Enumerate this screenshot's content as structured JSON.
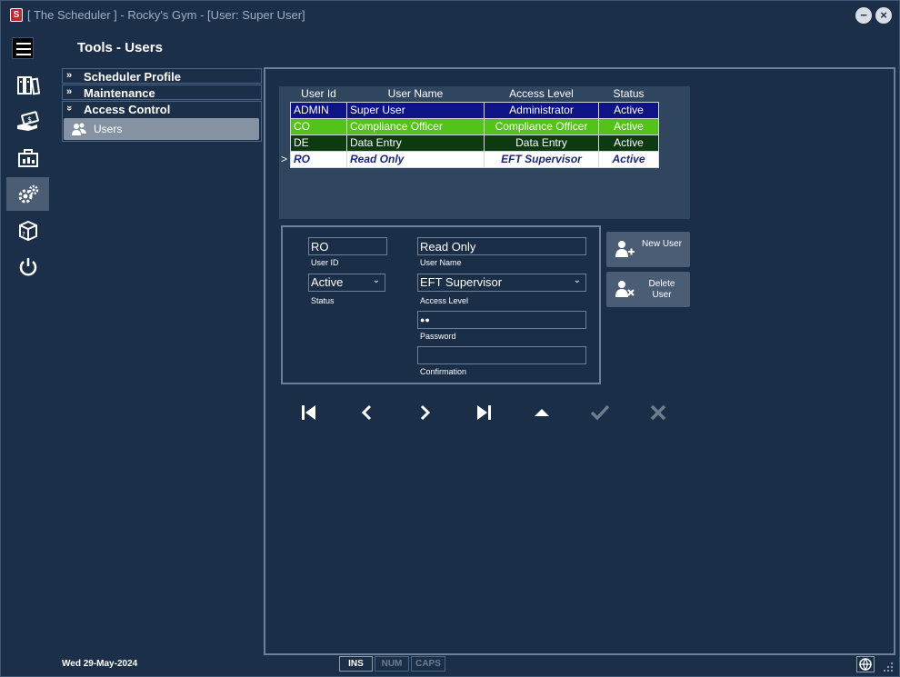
{
  "window": {
    "title": "[ The Scheduler ] - Rocky's Gym - [User: Super User]",
    "app_icon": "S",
    "minimize_label": "−",
    "close_label": "×"
  },
  "page_title": "Tools - Users",
  "tree": {
    "items": [
      {
        "label": "Scheduler Profile",
        "chevron": "»"
      },
      {
        "label": "Maintenance",
        "chevron": "»"
      },
      {
        "label": "Access Control",
        "chevron": "»"
      }
    ],
    "sub_item": "Users"
  },
  "grid": {
    "headers": [
      "User Id",
      "User Name",
      "Access Level",
      "Status"
    ],
    "rows": [
      {
        "id": "ADMIN",
        "name": "Super User",
        "level": "Administrator",
        "status": "Active"
      },
      {
        "id": "CO",
        "name": "Compliance Officer",
        "level": "Compliance Officer",
        "status": "Active"
      },
      {
        "id": "DE",
        "name": "Data Entry",
        "level": "Data Entry",
        "status": "Active"
      },
      {
        "id": "RO",
        "name": "Read Only",
        "level": "EFT Supervisor",
        "status": "Active"
      }
    ],
    "current_row_marker": ">"
  },
  "form": {
    "user_id": {
      "value": "RO",
      "label": "User ID"
    },
    "user_name": {
      "value": "Read Only",
      "label": "User Name"
    },
    "status": {
      "value": "Active",
      "label": "Status"
    },
    "access_level": {
      "value": "EFT Supervisor",
      "label": "Access Level"
    },
    "password": {
      "value": "●●",
      "label": "Password"
    },
    "confirmation": {
      "value": "",
      "label": "Confirmation"
    }
  },
  "buttons": {
    "new_user": "New User",
    "delete_user": "Delete User"
  },
  "statusbar": {
    "date": "Wed  29-May-2024",
    "ins": "INS",
    "num": "NUM",
    "caps": "CAPS"
  },
  "colors": {
    "background": "#1b2e47",
    "admin_row": "#0e1385",
    "co_row": "#53c317",
    "de_row": "#0d3a11",
    "ro_row": "#ffffff"
  }
}
